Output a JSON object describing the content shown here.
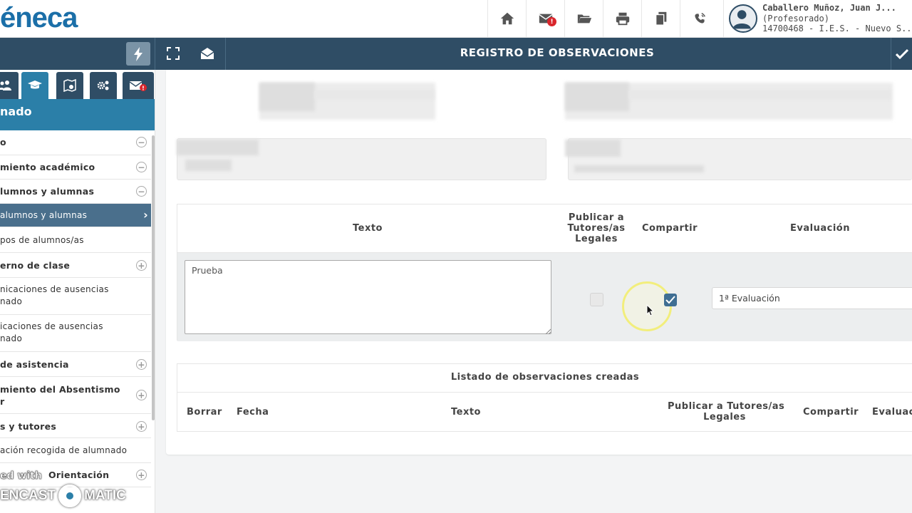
{
  "app": {
    "logo_text": "éneca"
  },
  "topbar": {
    "icons": [
      "home-icon",
      "mail-icon",
      "folder-open-icon",
      "print-icon",
      "copy-icon",
      "phone-icon"
    ],
    "mail_badge": "!",
    "user": {
      "name": "Caballero Muñoz, Juan J...",
      "role": "(Profesorado)",
      "center": "14700468 - I.E.S. - Nuevo S..."
    }
  },
  "header": {
    "title": "REGISTRO DE OBSERVACIONES"
  },
  "sidebar": {
    "tabs": [
      {
        "icon": "users-icon"
      },
      {
        "icon": "graduation-cap-icon",
        "active": true
      },
      {
        "icon": "map-settings-icon"
      },
      {
        "icon": "gears-icon"
      },
      {
        "icon": "mail-alert-icon",
        "badge": "!"
      }
    ],
    "header": "nado",
    "items": [
      {
        "label": "o",
        "toggle": "−"
      },
      {
        "label": "miento académico",
        "toggle": "−"
      },
      {
        "label": "lumnos y alumnas",
        "toggle": "−"
      },
      {
        "label": "alumnos y alumnas",
        "active": true
      },
      {
        "label": "pos de alumnos/as",
        "sub": true
      },
      {
        "label": "erno de clase",
        "toggle": "+"
      },
      {
        "label": "nicaciones de ausencias",
        "label2": "nado",
        "sub": true
      },
      {
        "label": "icaciones de ausencias",
        "label2": "nado",
        "sub": true
      },
      {
        "label": "de asistencia",
        "toggle": "+"
      },
      {
        "label": "miento del Absentismo",
        "label2": "r",
        "toggle": "+"
      },
      {
        "label": "s y tutores",
        "toggle": "+"
      },
      {
        "label": "ación recogida de alumnado",
        "sub": true
      },
      {
        "label": "Orientación",
        "toggle": "+"
      }
    ],
    "watermark": {
      "small": "ed with",
      "brand_left": "ENCAST",
      "brand_right": "MATIC"
    }
  },
  "form": {
    "columns": {
      "texto": "Texto",
      "publicar_l1": "Publicar a",
      "publicar_l2": "Tutores/as",
      "publicar_l3": "Legales",
      "compartir": "Compartir",
      "evaluacion": "Evaluación"
    },
    "texto_value": "Prueba",
    "publicar_checked": false,
    "compartir_checked": true,
    "evaluacion_value": "1ª Evaluación"
  },
  "list": {
    "title": "Listado de observaciones creadas",
    "columns": {
      "borrar": "Borrar",
      "fecha": "Fecha",
      "texto": "Texto",
      "publicar_l1": "Publicar a Tutores/as",
      "publicar_l2": "Legales",
      "compartir": "Compartir",
      "evaluacion": "Evaluac"
    }
  },
  "colors": {
    "header_band": "#2f4d65",
    "sidebar_accent": "#2b7fa8",
    "active_item": "#4a6f8c",
    "checkbox_checked": "#3f6e93"
  }
}
